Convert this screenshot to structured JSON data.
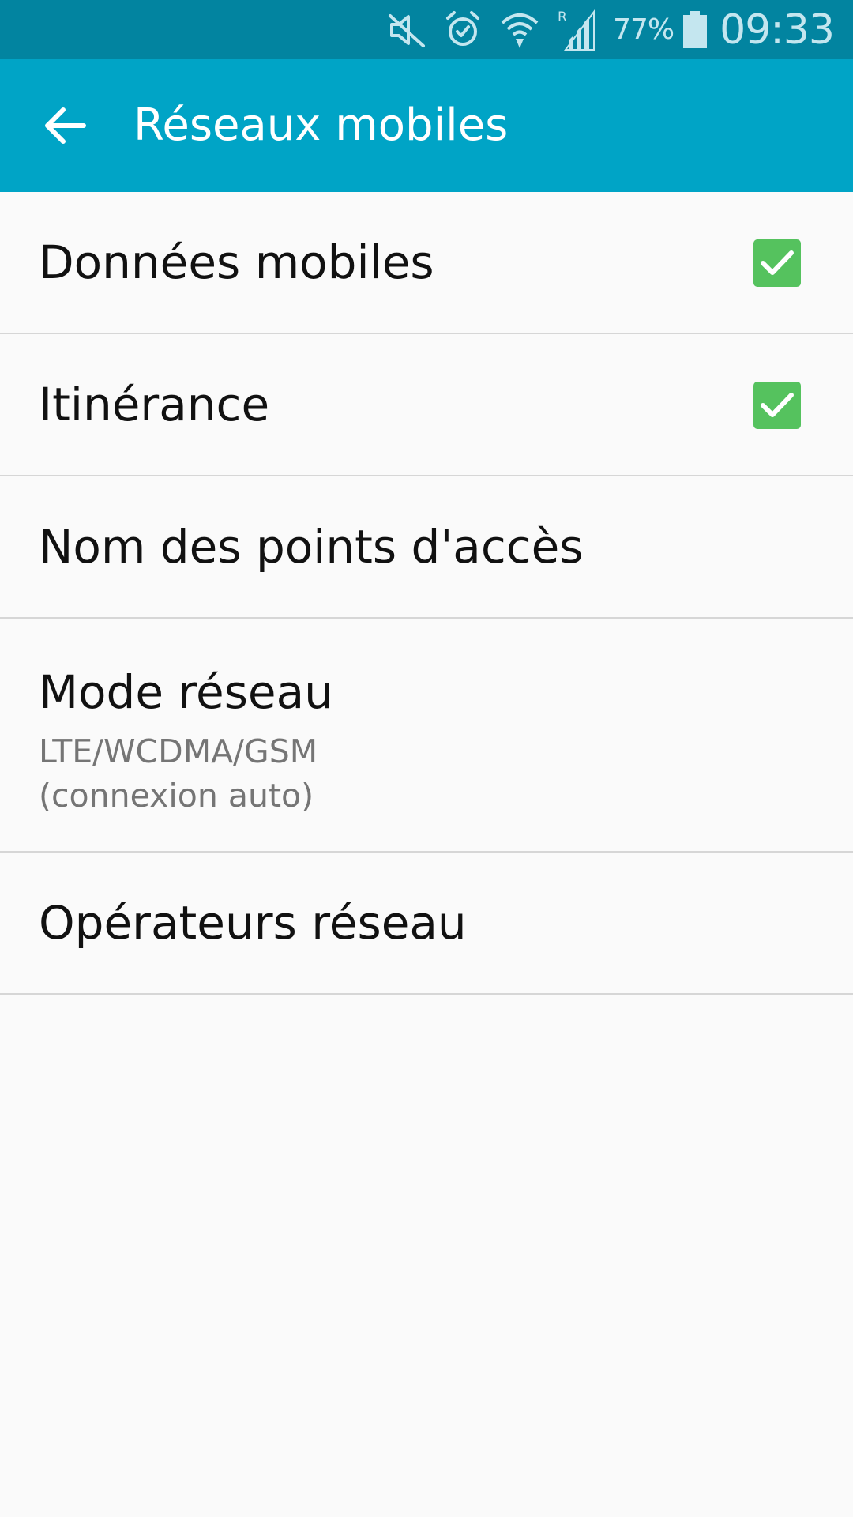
{
  "status_bar": {
    "icons": [
      "mute-icon",
      "alarm-icon",
      "wifi-icon",
      "roaming-signal-icon",
      "battery-icon"
    ],
    "battery_percent": "77%",
    "time": "09:33",
    "roaming_indicator": "R",
    "background_color": "#0284a0"
  },
  "app_bar": {
    "title": "Réseaux mobiles",
    "back_icon": "arrow-left-icon",
    "background_color": "#00a4c6"
  },
  "settings": {
    "items": [
      {
        "label": "Données mobiles",
        "checked": true
      },
      {
        "label": "Itinérance",
        "checked": true
      },
      {
        "label": "Nom des points d'accès"
      },
      {
        "label": "Mode réseau",
        "summary": "LTE/WCDMA/GSM\n(connexion auto)"
      },
      {
        "label": "Opérateurs réseau"
      }
    ]
  },
  "colors": {
    "checkbox_checked": "#55c25e",
    "divider": "#d6d6d6",
    "summary_text": "#757575"
  }
}
